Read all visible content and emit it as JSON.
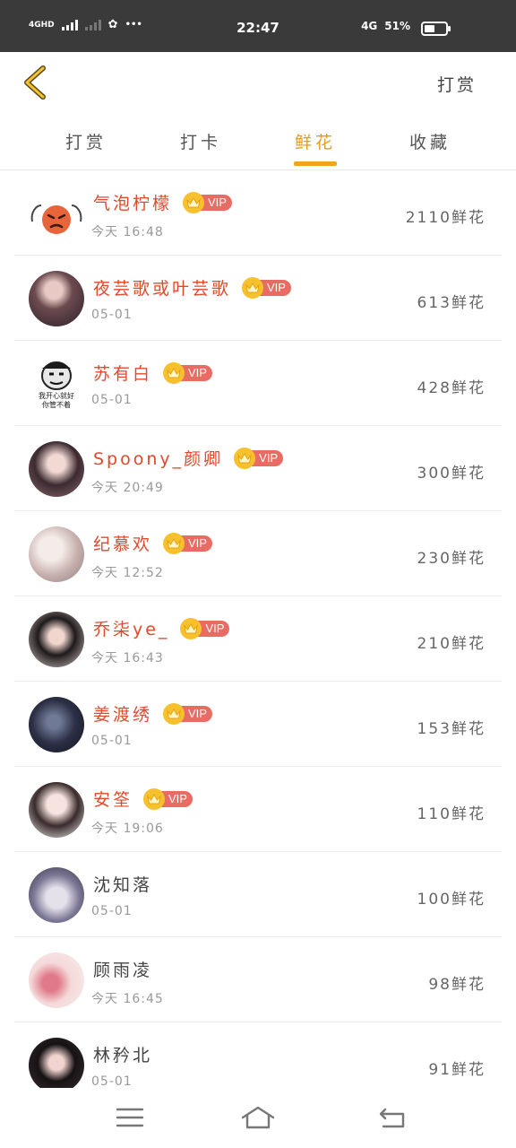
{
  "status_bar": {
    "network": "4GHD",
    "network2": "4G",
    "more": "•••",
    "time": "22:47",
    "battery": "51%",
    "battery_level": 0.51
  },
  "header": {
    "back_icon": "chevron-left-icon",
    "action_label": "打赏"
  },
  "tabs": [
    {
      "label": "打赏",
      "active": false
    },
    {
      "label": "打卡",
      "active": false
    },
    {
      "label": "鲜花",
      "active": true
    },
    {
      "label": "收藏",
      "active": false
    }
  ],
  "vip_label": "VIP",
  "accent_color": "#f0a31c",
  "name_color": "#e0492c",
  "users": [
    {
      "name": "气泡柠檬",
      "vip": true,
      "date": "今天 16:48",
      "amount": "2110鲜花"
    },
    {
      "name": "夜芸歌或叶芸歌",
      "vip": true,
      "date": "05-01",
      "amount": "613鲜花"
    },
    {
      "name": "苏有白",
      "vip": true,
      "date": "05-01",
      "amount": "428鲜花"
    },
    {
      "name": "Spoony_颜卿",
      "vip": true,
      "date": "今天 20:49",
      "amount": "300鲜花"
    },
    {
      "name": "纪慕欢",
      "vip": true,
      "date": "今天 12:52",
      "amount": "230鲜花"
    },
    {
      "name": "乔柒ye_",
      "vip": true,
      "date": "今天 16:43",
      "amount": "210鲜花"
    },
    {
      "name": "姜渡绣",
      "vip": true,
      "date": "05-01",
      "amount": "153鲜花"
    },
    {
      "name": "安筌",
      "vip": true,
      "date": "今天 19:06",
      "amount": "110鲜花"
    },
    {
      "name": "沈知落",
      "vip": false,
      "date": "05-01",
      "amount": "100鲜花"
    },
    {
      "name": "顾雨凌",
      "vip": false,
      "date": "今天 16:45",
      "amount": "98鲜花"
    },
    {
      "name": "林矜北",
      "vip": false,
      "date": "05-01",
      "amount": "91鲜花"
    }
  ],
  "meme_caption": [
    "我开心就好",
    "你管不着"
  ],
  "nav": {
    "menu_icon": "menu-icon",
    "home_icon": "home-icon",
    "back_icon": "back-icon"
  }
}
